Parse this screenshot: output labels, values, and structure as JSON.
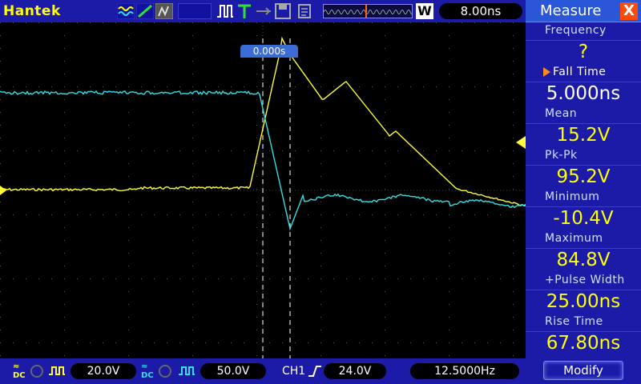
{
  "brand": "Hantek",
  "timebase": "8.00ns",
  "timebar_label": "W",
  "trigger_position": "0.000s",
  "channels": {
    "ch1": {
      "scale": "20.0V",
      "color": "#ffff33"
    },
    "ch2": {
      "scale": "50.0V",
      "color": "#33e0e8"
    }
  },
  "trigger": {
    "source": "CH1",
    "level": "24.0V",
    "frequency": "12.5000Hz"
  },
  "measure": {
    "title": "Measure",
    "close": "X",
    "items": [
      {
        "name": "Frequency",
        "value": "?"
      },
      {
        "name": "Fall Time",
        "value": "5.000ns",
        "selected": true
      },
      {
        "name": "Mean",
        "value": "15.2V"
      },
      {
        "name": "Pk-Pk",
        "value": "95.2V"
      },
      {
        "name": "Minimum",
        "value": "-10.4V"
      },
      {
        "name": "Maximum",
        "value": "84.8V"
      },
      {
        "name": "+Pulse Width",
        "value": "25.00ns"
      },
      {
        "name": "Rise Time",
        "value": "67.80ns"
      }
    ],
    "modify": "Modify"
  },
  "colors": {
    "bar": "#1b1ba8",
    "accent": "#2a56d8",
    "trace_ch1": "#ffff33",
    "trace_ch2": "#33e0e8"
  }
}
